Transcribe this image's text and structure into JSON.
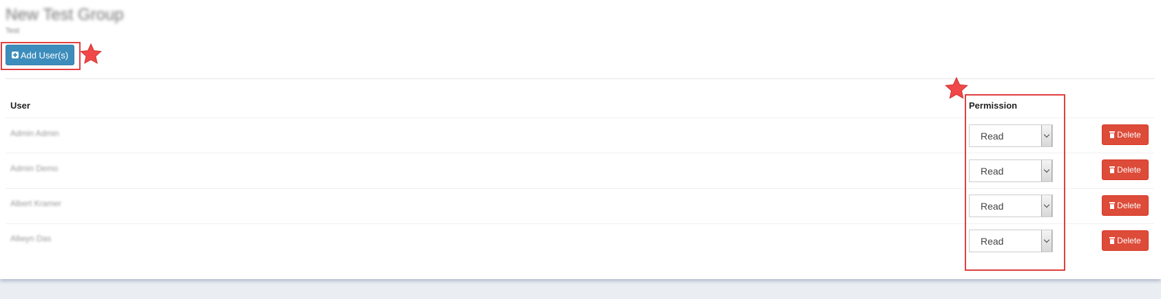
{
  "group": {
    "title": "New Test Group",
    "subtitle": "Test"
  },
  "toolbar": {
    "add_users_label": "Add User(s)",
    "add_users_icon": "plus-square-icon"
  },
  "table": {
    "columns": {
      "user": "User",
      "permission": "Permission"
    },
    "rows": [
      {
        "user": "Admin Admin",
        "permission": "Read",
        "delete_label": "Delete"
      },
      {
        "user": "Admin Demo",
        "permission": "Read",
        "delete_label": "Delete"
      },
      {
        "user": "Albert Kramer",
        "permission": "Read",
        "delete_label": "Delete"
      },
      {
        "user": "Allwyn Das",
        "permission": "Read",
        "delete_label": "Delete"
      }
    ]
  },
  "colors": {
    "primary": "#3c8dbc",
    "danger": "#dd4b39",
    "highlight": "#e03e3e",
    "star": "#f04848"
  }
}
